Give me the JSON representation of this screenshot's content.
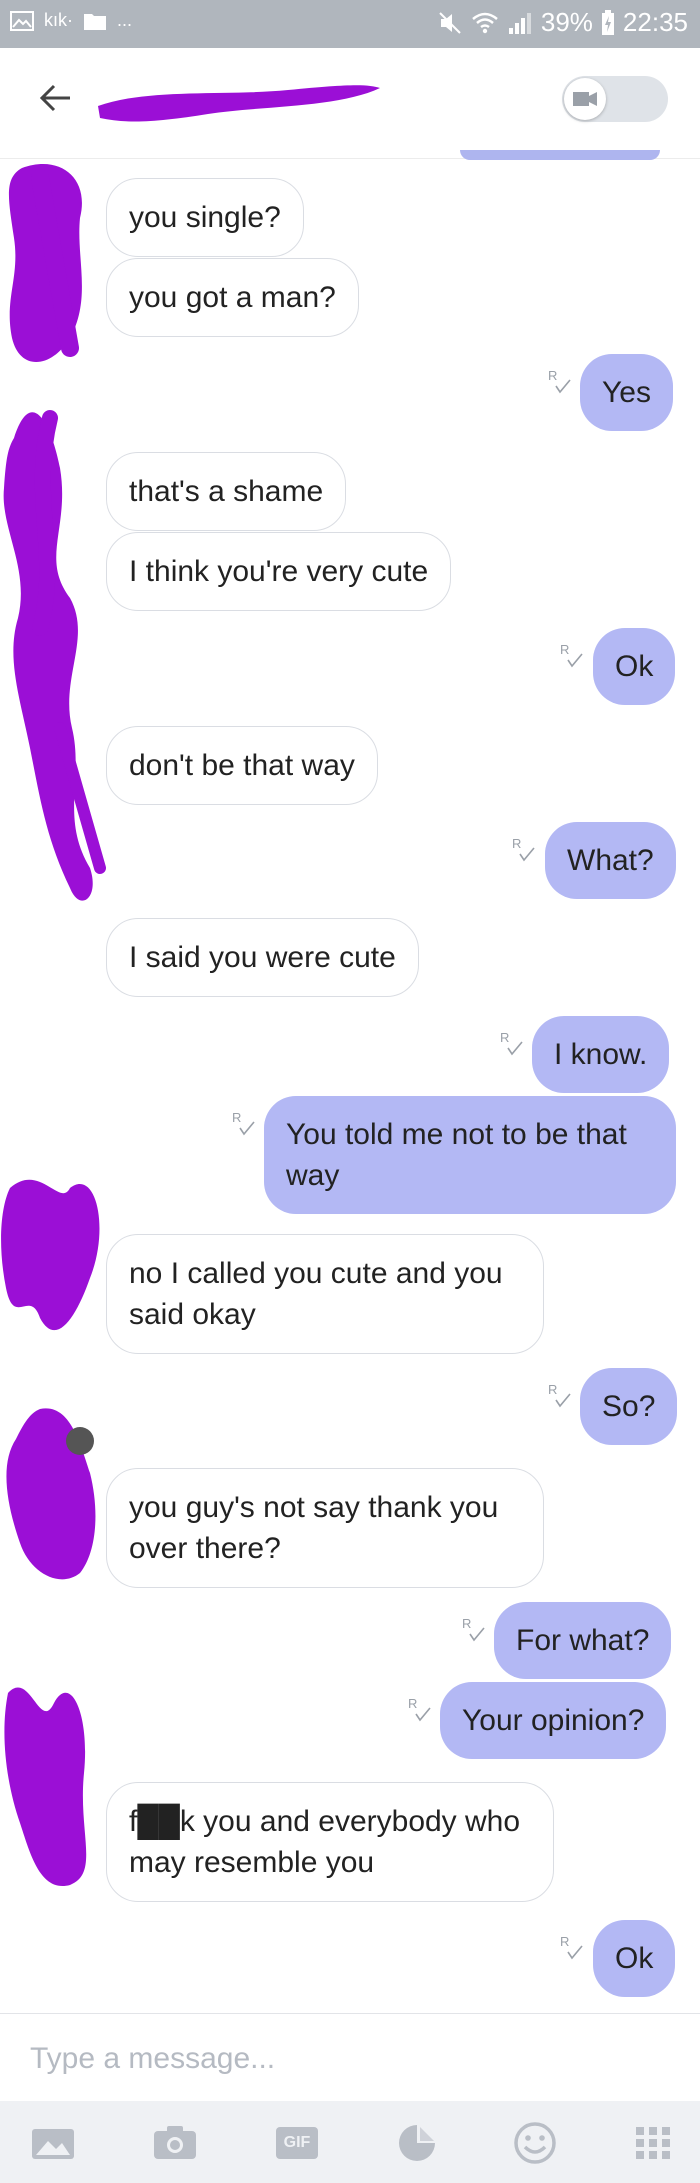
{
  "status_bar": {
    "app": "kık·",
    "dots": "...",
    "battery": "39%",
    "time": "22:35"
  },
  "header": {
    "back_icon": "arrow-left-icon",
    "video_icon": "video-camera-icon"
  },
  "messages": [
    {
      "from": "them",
      "text": "you single?"
    },
    {
      "from": "them",
      "text": "you got a man?"
    },
    {
      "from": "me",
      "text": "Yes",
      "receipt": "R"
    },
    {
      "from": "them",
      "text": "that's a shame"
    },
    {
      "from": "them",
      "text": "I think you're very cute"
    },
    {
      "from": "me",
      "text": "Ok",
      "receipt": "R"
    },
    {
      "from": "them",
      "text": "don't be that way"
    },
    {
      "from": "me",
      "text": "What?",
      "receipt": "R"
    },
    {
      "from": "them",
      "text": "I said you were cute"
    },
    {
      "from": "me",
      "text": "I know.",
      "receipt": "R"
    },
    {
      "from": "me",
      "text": "You told me not to be that way",
      "receipt": "R"
    },
    {
      "from": "them",
      "text": "no I called you cute and you said okay"
    },
    {
      "from": "me",
      "text": "So?",
      "receipt": "R"
    },
    {
      "from": "them",
      "text": "you guy's not say thank you over there?"
    },
    {
      "from": "me",
      "text": "For what?",
      "receipt": "R"
    },
    {
      "from": "me",
      "text": "Your opinion?",
      "receipt": "R"
    },
    {
      "from": "them",
      "text": "f██k you and everybody who may resemble you"
    },
    {
      "from": "me",
      "text": "Ok",
      "receipt": "R"
    }
  ],
  "composer": {
    "placeholder": "Type a message..."
  },
  "toolbar": {
    "gif_label": "GIF",
    "icons": [
      "gallery-icon",
      "camera-icon",
      "gif-icon",
      "sticker-icon",
      "emoji-icon",
      "apps-grid-icon"
    ]
  },
  "colors": {
    "outgoing_bubble": "#b3b8f4",
    "incoming_border": "#dadde3",
    "redaction": "#9b0fd6",
    "status_bar": "#b0b6bd"
  }
}
